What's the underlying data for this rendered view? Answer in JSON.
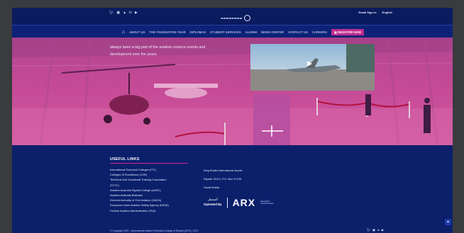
{
  "header": {
    "social_icons": [
      "twitter-icon",
      "instagram-icon",
      "snapchat-icon",
      "linkedin-icon",
      "youtube-icon"
    ],
    "email_sign_in": "Email Sign in",
    "language": "English"
  },
  "nav": {
    "items": [
      "ABOUT US",
      "THE FOUNDATION YEAR",
      "DIPLOMAS",
      "STUDENT SERVICES",
      "ALUMNI",
      "NEWS CENTER",
      "CONTACT US",
      "CAREERS"
    ],
    "register": "REGISTER NOW"
  },
  "hero": {
    "text_line1": "always been a big part of the aviation science events and",
    "text_line2": "development over the years."
  },
  "footer": {
    "useful_links_title": "USEFUL LINKS",
    "links": [
      "International Technical Colleges (ITC)",
      "Colleges Of Excellence (COE)",
      "Technical And Vocational Training Corporation",
      "(TVTC)",
      "Aviation Australia Riyadh College (AARC)",
      "Aviation Australia Brisbane",
      "General Authority of Civil Aviation (GACA)",
      "European Union Aviation Safety Agency (EASA)",
      "Federal Aviation Administration (FAA)"
    ],
    "address": [
      "King Khalid International Airport",
      "Riyadh 14212, P.O. Box 47139",
      "Saudi Arabia"
    ],
    "operated_by_ar": "المشغل",
    "operated_by": "Operated By",
    "arx": "ARX",
    "arx_sub": "Aerospace Transformation",
    "copyright": "© Copyright 2020 - International Aviation Technical College of Riyadh (IATC) | CEO",
    "social_icons": [
      "twitter-icon",
      "instagram-icon",
      "linkedin-icon",
      "youtube-icon"
    ]
  },
  "colors": {
    "navy": "#0b1f6b",
    "magenta": "#c22b8c",
    "hero_tint": "#c54a96"
  }
}
